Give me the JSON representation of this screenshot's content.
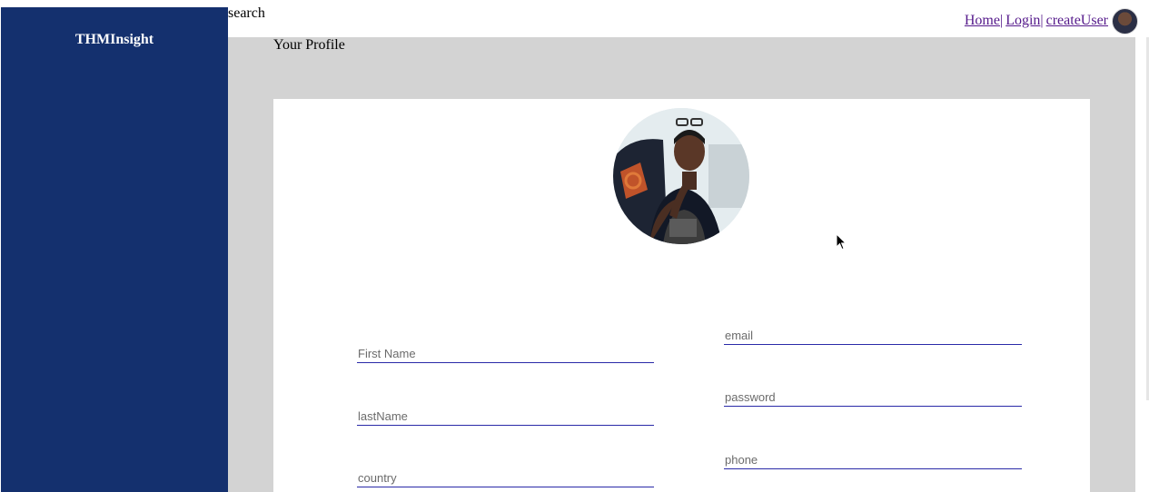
{
  "sidebar": {
    "brand": "THMInsight",
    "color": "#14306e"
  },
  "topbar": {
    "search_label": "search"
  },
  "nav": {
    "home": "Home ",
    "login": "Login ",
    "create_user": "createUser",
    "separator": "|",
    "link_color": "#551a8b"
  },
  "page": {
    "title": "Your Profile"
  },
  "form": {
    "first_name": {
      "placeholder": "First Name",
      "value": ""
    },
    "last_name": {
      "placeholder": "lastName",
      "value": ""
    },
    "country": {
      "placeholder": "country",
      "value": ""
    },
    "email": {
      "placeholder": "email",
      "value": ""
    },
    "password": {
      "placeholder": "password",
      "value": ""
    },
    "phone": {
      "placeholder": "phone",
      "value": ""
    }
  }
}
